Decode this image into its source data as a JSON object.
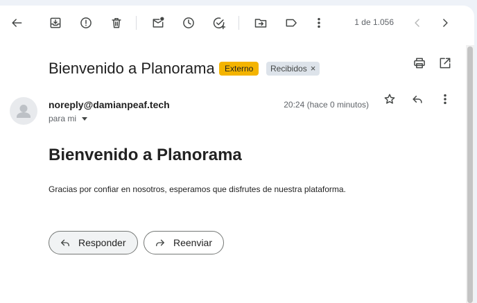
{
  "toolbar": {
    "counter": "1 de 1.056",
    "icons": [
      "back-icon",
      "archive-icon",
      "report-spam-icon",
      "delete-icon",
      "mark-unread-icon",
      "snooze-icon",
      "add-task-icon",
      "move-to-icon",
      "label-icon",
      "more-vert-icon",
      "prev-icon",
      "next-icon"
    ]
  },
  "email": {
    "subject": "Bienvenido a Planorama",
    "labels": {
      "external": "Externo",
      "inbox": "Recibidos",
      "remove": "×"
    },
    "sender": "noreply@damianpeaf.tech",
    "to": "para mi",
    "time": "20:24 (hace 0 minutos)",
    "heading": "Bienvenido a Planorama",
    "body": "Gracias por confiar en nosotros, esperamos que disfrutes de nuestra plataforma."
  },
  "actions": {
    "reply": "Responder",
    "forward": "Reenviar"
  },
  "colors": {
    "external_chip": "#f4b400",
    "inbox_chip": "#dde3ea",
    "page_bg": "#eef2f8"
  }
}
